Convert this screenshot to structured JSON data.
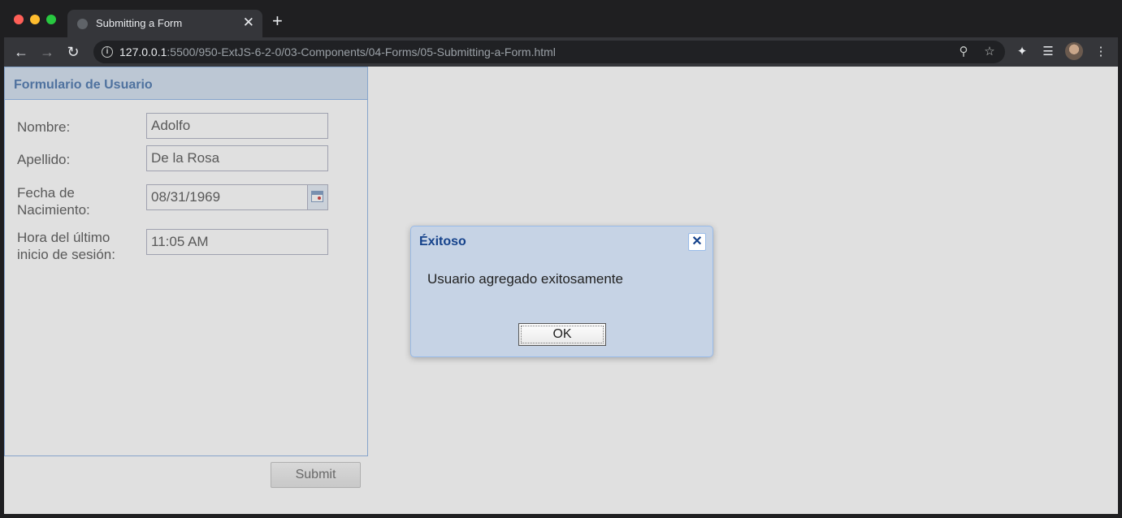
{
  "browser": {
    "tab_title": "Submitting a Form",
    "new_tab_symbol": "+",
    "tab_close_symbol": "✕",
    "url_host": "127.0.0.1",
    "url_path": ":5500/950-ExtJS-6-2-0/03-Components/04-Forms/05-Submitting-a-Form.html",
    "icons": [
      "back-icon",
      "forward-icon",
      "reload-icon",
      "info-icon",
      "zoom-icon",
      "star-icon",
      "extensions-icon",
      "reading-list-icon",
      "avatar",
      "menu-icon"
    ]
  },
  "form": {
    "title": "Formulario de Usuario",
    "fields": [
      {
        "label": "Nombre:",
        "value": "Adolfo"
      },
      {
        "label": "Apellido:",
        "value": "De la Rosa"
      },
      {
        "label": "Fecha de Nacimiento:",
        "value": "08/31/1969"
      },
      {
        "label": "Hora del último inicio de sesión:",
        "value": "11:05 AM"
      }
    ],
    "submit_label": "Submit"
  },
  "dialog": {
    "title": "Éxitoso",
    "message": "Usuario agregado exitosamente",
    "ok_label": "OK"
  },
  "colors": {
    "panel_header": "#d6e3f2",
    "panel_title": "#5b82b5",
    "dialog_bg": "#c6d3e5",
    "dialog_title": "#15428b"
  }
}
